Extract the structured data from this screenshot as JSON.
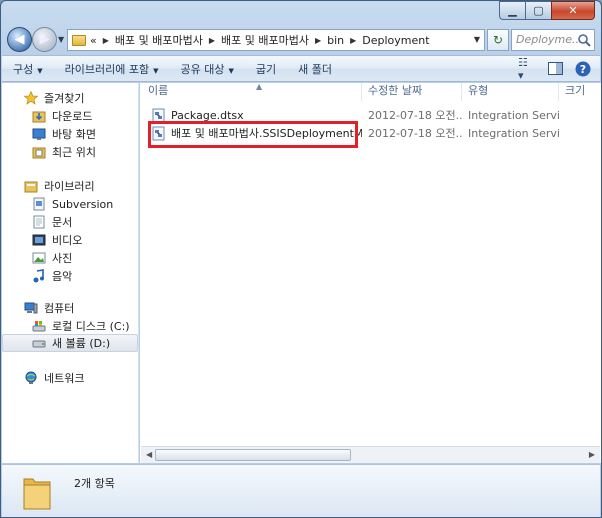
{
  "window": {
    "controls": {
      "minimize": "▁",
      "maximize": "▢",
      "close": "✕"
    }
  },
  "address": {
    "overflow": "«",
    "crumbs": [
      "배포 및 배포마법사",
      "배포 및 배포마법사",
      "bin",
      "Deployment"
    ],
    "search_placeholder": "Deployme..."
  },
  "toolbar": {
    "organize": "구성",
    "include_in_library": "라이브러리에 포함",
    "share_with": "공유 대상",
    "burn": "굽기",
    "new_folder": "새 폴더"
  },
  "nav": {
    "favorites": {
      "label": "즐겨찾기",
      "items": [
        "다운로드",
        "바탕 화면",
        "최근 위치"
      ]
    },
    "libraries": {
      "label": "라이브러리",
      "items": [
        "Subversion",
        "문서",
        "비디오",
        "사진",
        "음악"
      ]
    },
    "computer": {
      "label": "컴퓨터",
      "items": [
        "로컬 디스크 (C:)",
        "새 볼륨 (D:)"
      ]
    },
    "network": {
      "label": "네트워크"
    }
  },
  "columns": {
    "name": "이름",
    "date": "수정한 날짜",
    "type": "유형",
    "size": "크기"
  },
  "files": [
    {
      "name": "Package.dtsx",
      "date": "2012-07-18 오전...",
      "type": "Integration Servic..."
    },
    {
      "name": "배포 및 배포마법사.SSISDeploymentMa...",
      "date": "2012-07-18 오전...",
      "type": "Integration Servic..."
    }
  ],
  "details": {
    "count": "2개 항목"
  },
  "colors": {
    "highlight": "#e3202a",
    "accent": "#4d6a8d"
  }
}
